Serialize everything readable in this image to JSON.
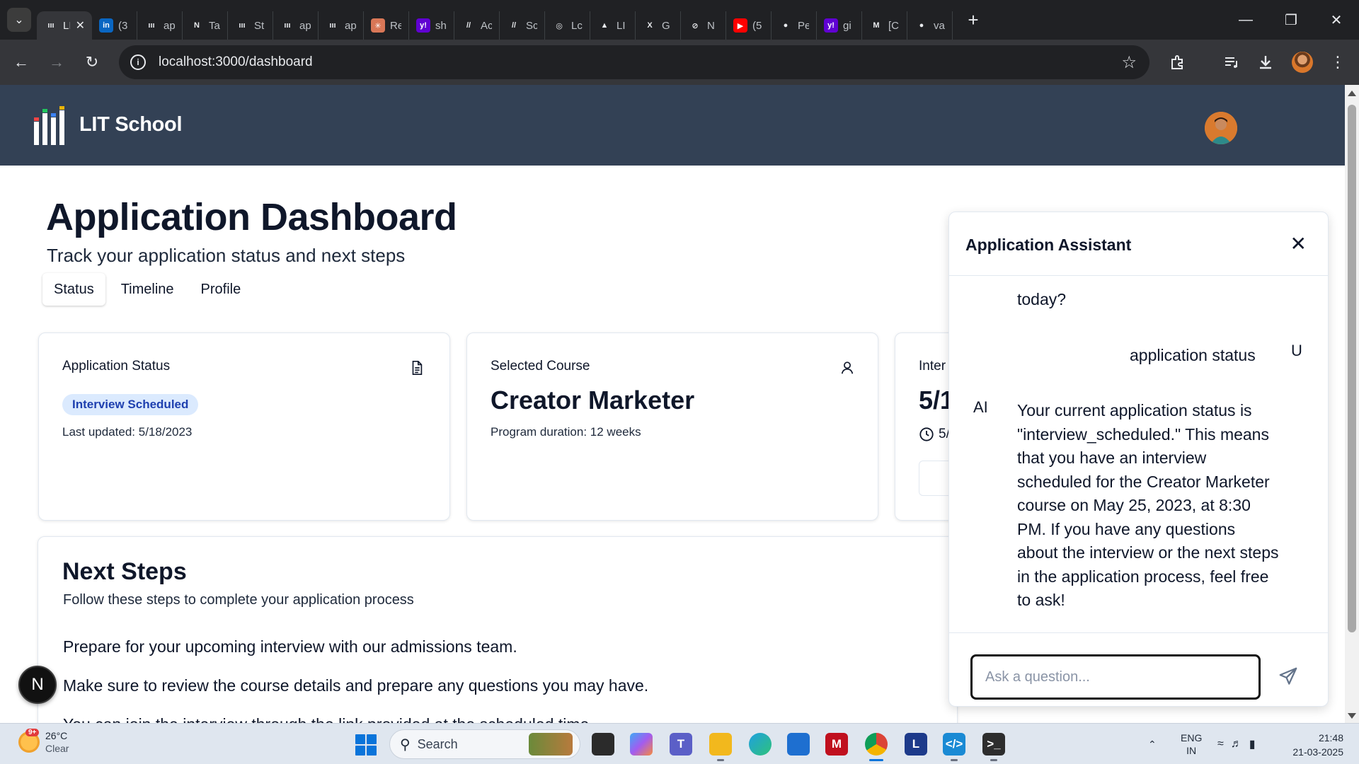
{
  "browser": {
    "tabs": [
      {
        "title": "LI",
        "favicon": "lit-logo",
        "active": true
      },
      {
        "title": "(3",
        "favicon": "linkedin-icon",
        "color": "#0a66c2"
      },
      {
        "title": "ap",
        "favicon": "lit-logo"
      },
      {
        "title": "Ta",
        "favicon": "notion-icon"
      },
      {
        "title": "St",
        "favicon": "lit-logo"
      },
      {
        "title": "ap",
        "favicon": "lit-logo"
      },
      {
        "title": "ap",
        "favicon": "lit-logo"
      },
      {
        "title": "Re",
        "favicon": "claude-icon",
        "color": "#d97757"
      },
      {
        "title": "sh",
        "favicon": "yahoo-icon",
        "color": "#6001d2"
      },
      {
        "title": "Ac",
        "favicon": "slash-icon"
      },
      {
        "title": "Sc",
        "favicon": "slash-icon"
      },
      {
        "title": "Lc",
        "favicon": "openai-icon"
      },
      {
        "title": "LI",
        "favicon": "vercel-icon"
      },
      {
        "title": "G",
        "favicon": "x-icon"
      },
      {
        "title": "N",
        "favicon": "circle-slash-icon"
      },
      {
        "title": "(5",
        "favicon": "youtube-icon",
        "color": "#ff0000"
      },
      {
        "title": "Pe",
        "favicon": "github-icon"
      },
      {
        "title": "gi",
        "favicon": "yahoo-icon",
        "color": "#6001d2"
      },
      {
        "title": "[C",
        "favicon": "gmail-icon"
      },
      {
        "title": "va",
        "favicon": "github-icon"
      }
    ],
    "url": "localhost:3000/dashboard"
  },
  "app": {
    "brand": "LIT School"
  },
  "dashboard": {
    "title": "Application Dashboard",
    "subtitle": "Track your application status and next steps",
    "tabs": [
      "Status",
      "Timeline",
      "Profile"
    ],
    "active_tab": "Status",
    "cards": {
      "status": {
        "label": "Application Status",
        "badge": "Interview Scheduled",
        "meta": "Last updated: 5/18/2023"
      },
      "course": {
        "label": "Selected Course",
        "value": "Creator Marketer",
        "meta": "Program duration: 12 weeks"
      },
      "interview": {
        "label": "Inter",
        "value": "5/1",
        "meta": "5/"
      }
    },
    "next_steps": {
      "title": "Next Steps",
      "subtitle": "Follow these steps to complete your application process",
      "items": [
        "Prepare for your upcoming interview with our admissions team.",
        "Make sure to review the course details and prepare any questions you may have.",
        "You can join the interview through the link provided at the scheduled time."
      ]
    },
    "float_badge": "N"
  },
  "assistant": {
    "title": "Application Assistant",
    "messages": [
      {
        "role": "AI",
        "text": "today?"
      },
      {
        "role": "U",
        "text": "application status"
      },
      {
        "role": "AI",
        "text": "Your current application status is \"interview_scheduled.\" This means that you have an interview scheduled for the Creator Marketer course on May 25, 2023, at 8:30 PM. If you have any questions about the interview or the next steps in the application process, feel free to ask!"
      }
    ],
    "input_placeholder": "Ask a question..."
  },
  "taskbar": {
    "weather": {
      "temp": "26°C",
      "condition": "Clear",
      "badge": "9+"
    },
    "search_label": "Search",
    "language": {
      "line1": "ENG",
      "line2": "IN"
    },
    "time": "21:48",
    "date": "21-03-2025"
  }
}
